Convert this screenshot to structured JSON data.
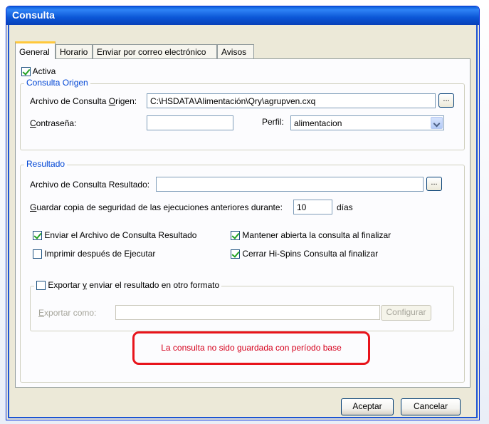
{
  "window": {
    "title": "Consulta"
  },
  "tabs": [
    "General",
    "Horario",
    "Enviar por correo electrónico",
    "Avisos"
  ],
  "general": {
    "activa_label": "Activa",
    "activa_checked": true
  },
  "consulta_origen": {
    "legend": "Consulta Origen",
    "archivo_label_pre": "Archivo de Consulta ",
    "archivo_label_u": "O",
    "archivo_label_post": "rigen:",
    "archivo_value": "C:\\HSDATA\\Alimentación\\Qry\\agrupven.cxq",
    "browse_label": "...",
    "contrasena_label_u": "C",
    "contrasena_label_post": "ontraseña:",
    "contrasena_value": "",
    "perfil_label": "Perfil:",
    "perfil_value": "alimentacion"
  },
  "resultado": {
    "legend": "Resultado",
    "archivo_label": "Archivo de Consulta Resultado:",
    "archivo_value": "",
    "browse_label": "...",
    "guardar_label_u": "G",
    "guardar_label_post": "uardar copia de seguridad de las ejecuciones anteriores durante:",
    "guardar_value": "10",
    "dias_label": "días",
    "enviar_label": "Enviar el Archivo de Consulta Resultado",
    "enviar_checked": true,
    "imprimir_label": "Imprimir después de Ejecutar",
    "imprimir_checked": false,
    "mantener_label": "Mantener abierta la consulta al finalizar",
    "mantener_checked": true,
    "cerrar_label": "Cerrar Hi-Spins Consulta al finalizar",
    "cerrar_checked": true
  },
  "exportar": {
    "legend_pre": "Exportar ",
    "legend_u": "y",
    "legend_post": " enviar el resultado en otro formato",
    "checked": false,
    "exportar_como_u": "E",
    "exportar_como_post": "xportar como:",
    "exportar_value": "",
    "configurar_label": "Configurar"
  },
  "warning_text": "La consulta no sido guardada con período base",
  "buttons": {
    "aceptar": "Aceptar",
    "cancelar": "Cancelar"
  },
  "colors": {
    "warning_border": "#e8141b",
    "warning_text": "#d5001c",
    "title_bar": "#0a5fd8"
  }
}
